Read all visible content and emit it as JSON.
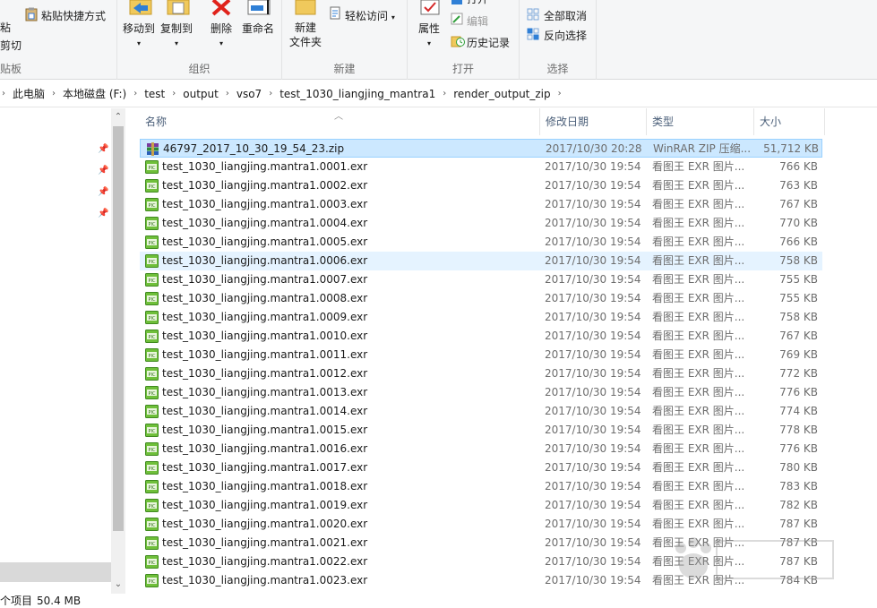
{
  "ribbon": {
    "clipboard": {
      "paste_fragment": "粘",
      "paste_shortcut": "粘贴快捷方式",
      "cut": "剪切",
      "group": "贴板"
    },
    "organize": {
      "move_to": "移动到",
      "copy_to": "复制到",
      "delete": "删除",
      "rename": "重命名",
      "group": "组织"
    },
    "new": {
      "new_folder_line1": "新建",
      "new_folder_line2": "文件夹",
      "easy_access": "轻松访问",
      "group": "新建"
    },
    "open": {
      "properties": "属性",
      "open": "打开",
      "edit": "编辑",
      "history": "历史记录",
      "group": "打开"
    },
    "select": {
      "select_none": "全部取消",
      "invert": "反向选择",
      "group": "选择"
    }
  },
  "address": {
    "crumbs": [
      "此电脑",
      "本地磁盘 (F:)",
      "test",
      "output",
      "vso7",
      "test_1030_liangjing_mantra1",
      "render_output_zip"
    ]
  },
  "list": {
    "headers": {
      "name": "名称",
      "date": "修改日期",
      "type": "类型",
      "size": "大小"
    },
    "rows": [
      {
        "name": "46797_2017_10_30_19_54_23.zip",
        "date": "2017/10/30 20:28",
        "type": "WinRAR ZIP 压缩...",
        "size": "51,712 KB",
        "icon": "winrar-icon"
      },
      {
        "name": "test_1030_liangjing.mantra1.0001.exr",
        "date": "2017/10/30 19:54",
        "type": "看图王 EXR 图片...",
        "size": "766 KB",
        "icon": "exr-icon"
      },
      {
        "name": "test_1030_liangjing.mantra1.0002.exr",
        "date": "2017/10/30 19:54",
        "type": "看图王 EXR 图片...",
        "size": "763 KB",
        "icon": "exr-icon"
      },
      {
        "name": "test_1030_liangjing.mantra1.0003.exr",
        "date": "2017/10/30 19:54",
        "type": "看图王 EXR 图片...",
        "size": "767 KB",
        "icon": "exr-icon"
      },
      {
        "name": "test_1030_liangjing.mantra1.0004.exr",
        "date": "2017/10/30 19:54",
        "type": "看图王 EXR 图片...",
        "size": "770 KB",
        "icon": "exr-icon"
      },
      {
        "name": "test_1030_liangjing.mantra1.0005.exr",
        "date": "2017/10/30 19:54",
        "type": "看图王 EXR 图片...",
        "size": "766 KB",
        "icon": "exr-icon"
      },
      {
        "name": "test_1030_liangjing.mantra1.0006.exr",
        "date": "2017/10/30 19:54",
        "type": "看图王 EXR 图片...",
        "size": "758 KB",
        "icon": "exr-icon"
      },
      {
        "name": "test_1030_liangjing.mantra1.0007.exr",
        "date": "2017/10/30 19:54",
        "type": "看图王 EXR 图片...",
        "size": "755 KB",
        "icon": "exr-icon"
      },
      {
        "name": "test_1030_liangjing.mantra1.0008.exr",
        "date": "2017/10/30 19:54",
        "type": "看图王 EXR 图片...",
        "size": "755 KB",
        "icon": "exr-icon"
      },
      {
        "name": "test_1030_liangjing.mantra1.0009.exr",
        "date": "2017/10/30 19:54",
        "type": "看图王 EXR 图片...",
        "size": "758 KB",
        "icon": "exr-icon"
      },
      {
        "name": "test_1030_liangjing.mantra1.0010.exr",
        "date": "2017/10/30 19:54",
        "type": "看图王 EXR 图片...",
        "size": "767 KB",
        "icon": "exr-icon"
      },
      {
        "name": "test_1030_liangjing.mantra1.0011.exr",
        "date": "2017/10/30 19:54",
        "type": "看图王 EXR 图片...",
        "size": "769 KB",
        "icon": "exr-icon"
      },
      {
        "name": "test_1030_liangjing.mantra1.0012.exr",
        "date": "2017/10/30 19:54",
        "type": "看图王 EXR 图片...",
        "size": "772 KB",
        "icon": "exr-icon"
      },
      {
        "name": "test_1030_liangjing.mantra1.0013.exr",
        "date": "2017/10/30 19:54",
        "type": "看图王 EXR 图片...",
        "size": "776 KB",
        "icon": "exr-icon"
      },
      {
        "name": "test_1030_liangjing.mantra1.0014.exr",
        "date": "2017/10/30 19:54",
        "type": "看图王 EXR 图片...",
        "size": "774 KB",
        "icon": "exr-icon"
      },
      {
        "name": "test_1030_liangjing.mantra1.0015.exr",
        "date": "2017/10/30 19:54",
        "type": "看图王 EXR 图片...",
        "size": "778 KB",
        "icon": "exr-icon"
      },
      {
        "name": "test_1030_liangjing.mantra1.0016.exr",
        "date": "2017/10/30 19:54",
        "type": "看图王 EXR 图片...",
        "size": "776 KB",
        "icon": "exr-icon"
      },
      {
        "name": "test_1030_liangjing.mantra1.0017.exr",
        "date": "2017/10/30 19:54",
        "type": "看图王 EXR 图片...",
        "size": "780 KB",
        "icon": "exr-icon"
      },
      {
        "name": "test_1030_liangjing.mantra1.0018.exr",
        "date": "2017/10/30 19:54",
        "type": "看图王 EXR 图片...",
        "size": "783 KB",
        "icon": "exr-icon"
      },
      {
        "name": "test_1030_liangjing.mantra1.0019.exr",
        "date": "2017/10/30 19:54",
        "type": "看图王 EXR 图片...",
        "size": "782 KB",
        "icon": "exr-icon"
      },
      {
        "name": "test_1030_liangjing.mantra1.0020.exr",
        "date": "2017/10/30 19:54",
        "type": "看图王 EXR 图片...",
        "size": "787 KB",
        "icon": "exr-icon"
      },
      {
        "name": "test_1030_liangjing.mantra1.0021.exr",
        "date": "2017/10/30 19:54",
        "type": "看图王 EXR 图片...",
        "size": "787 KB",
        "icon": "exr-icon"
      },
      {
        "name": "test_1030_liangjing.mantra1.0022.exr",
        "date": "2017/10/30 19:54",
        "type": "看图王 EXR 图片...",
        "size": "787 KB",
        "icon": "exr-icon"
      },
      {
        "name": "test_1030_liangjing.mantra1.0023.exr",
        "date": "2017/10/30 19:54",
        "type": "看图王 EXR 图片...",
        "size": "784 KB",
        "icon": "exr-icon"
      }
    ],
    "selected_index": 0,
    "hover_index": 6
  },
  "status": {
    "items_fragment": "个项目",
    "size": "50.4 MB"
  },
  "colors": {
    "selected_bg": "#cce8ff",
    "hover_bg": "#e5f3ff",
    "header_text": "#4c607a",
    "ribbon_bg": "#f5f6f7"
  }
}
